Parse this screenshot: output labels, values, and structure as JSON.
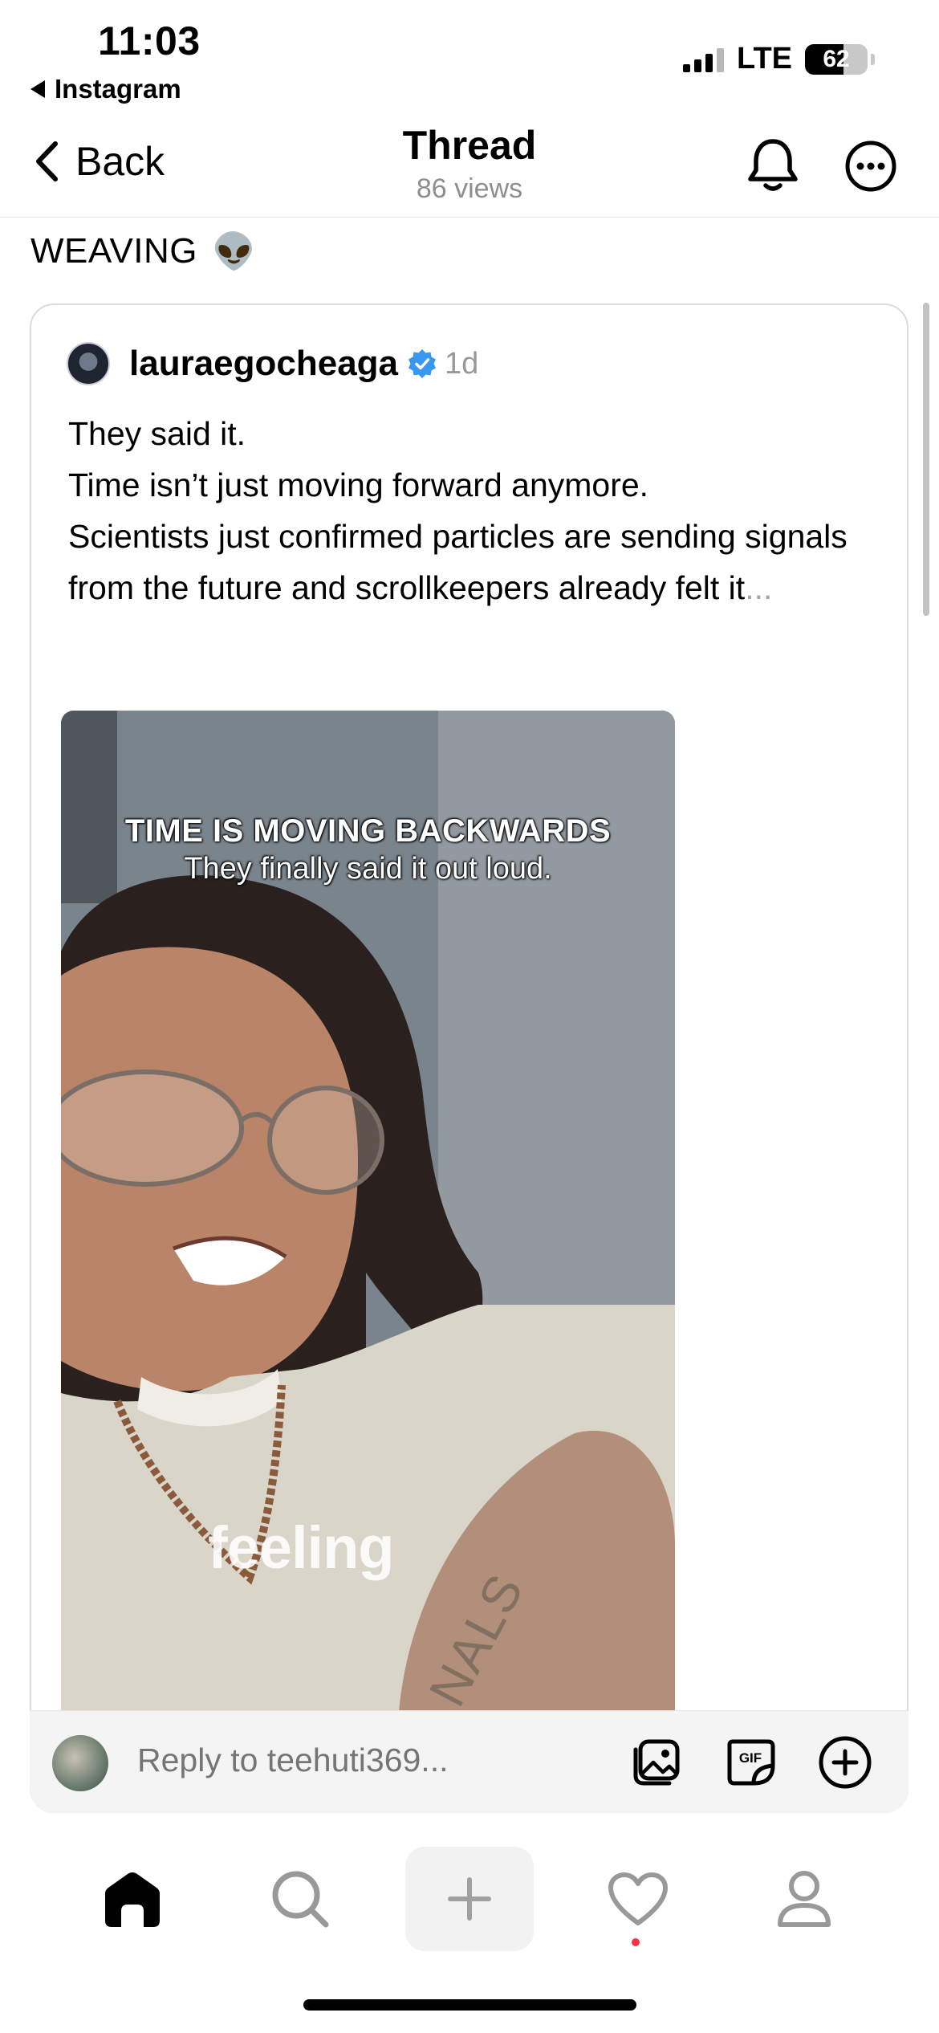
{
  "status_bar": {
    "time": "11:03",
    "back_app": "Instagram",
    "network": "LTE",
    "battery": "62",
    "battery_level": 0.62
  },
  "header": {
    "back_label": "Back",
    "title": "Thread",
    "views": "86 views"
  },
  "thread": {
    "cut_text": "WEAVING",
    "cut_emoji": "👽"
  },
  "quoted_post": {
    "username": "lauraegocheaga",
    "time_ago": "1d",
    "verified": true,
    "body_lines": [
      "They said it.",
      "Time isn’t just moving forward anymore.",
      "Scientists just confirmed particles are sending signals from the future and scrollkeepers already felt it"
    ],
    "ellipsis": "..."
  },
  "video": {
    "caption_line1": "TIME IS MOVING BACKWARDS",
    "caption_line2": "They finally said it out loud.",
    "subtitle_word": "feeling",
    "shirt_text": "NALS"
  },
  "reply_bar": {
    "placeholder": "Reply to teehuti369...",
    "icons": [
      "gallery-icon",
      "gif-icon",
      "add-circle-icon"
    ]
  },
  "tab_bar": {
    "items": [
      "home-icon",
      "search-icon",
      "plus-icon",
      "heart-icon",
      "profile-icon"
    ],
    "active": "home-icon",
    "has_notification": true
  },
  "colors": {
    "verified_blue": "#3897f0",
    "notification_red": "#ff3040",
    "muted_text": "#8e8e8e"
  }
}
